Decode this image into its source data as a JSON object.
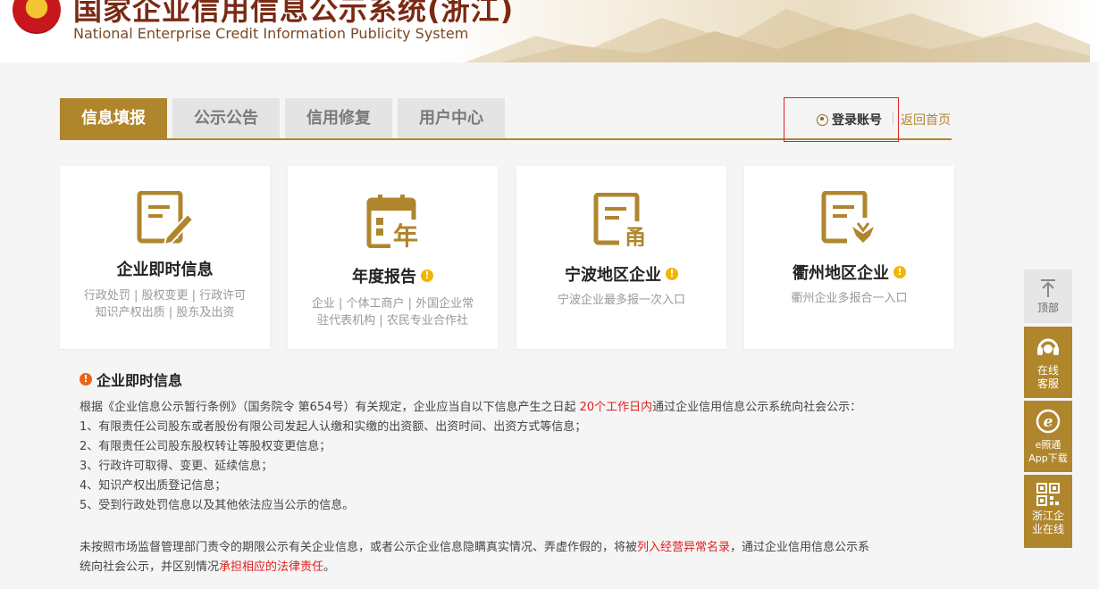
{
  "header": {
    "title_cn": "国家企业信用信息公示系统(浙江)",
    "title_en": "National Enterprise Credit Information Publicity System"
  },
  "tabs": [
    {
      "label": "信息填报",
      "active": true
    },
    {
      "label": "公示公告",
      "active": false
    },
    {
      "label": "信用修复",
      "active": false
    },
    {
      "label": "用户中心",
      "active": false
    }
  ],
  "top_links": {
    "login": "登录账号",
    "home": "返回首页"
  },
  "cards": [
    {
      "title": "企业即时信息",
      "desc": [
        "行政处罚 | 股权变更 | 行政许可",
        "知识产权出质 | 股东及出资"
      ],
      "warn": false,
      "icon": "document-pen-icon"
    },
    {
      "title": "年度报告",
      "desc": [
        "企业 | 个体工商户 | 外国企业常",
        "驻代表机构 | 农民专业合作社"
      ],
      "warn": true,
      "icon": "calendar-year-icon",
      "icon_text": "年"
    },
    {
      "title": "宁波地区企业",
      "desc": [
        "宁波企业最多报一次入口"
      ],
      "warn": true,
      "icon": "document-ningbo-icon",
      "icon_text": "甬"
    },
    {
      "title": "衢州地区企业",
      "desc": [
        "衢州企业多报合一入口"
      ],
      "warn": true,
      "icon": "document-quzhou-icon"
    }
  ],
  "info": {
    "title": "企业即时信息",
    "para1_a": "根据《企业信息公示暂行条例》（国务院令 第654号）有关规定，企业应当自以下信息产生之日起 ",
    "para1_red": "20个工作日内",
    "para1_b": "通过企业信用信息公示系统向社会公示：",
    "items": [
      "1、有限责任公司股东或者股份有限公司发起人认缴和实缴的出资额、出资时间、出资方式等信息；",
      "2、有限责任公司股东股权转让等股权变更信息；",
      "3、行政许可取得、变更、延续信息；",
      "4、知识产权出质登记信息；",
      "5、受到行政处罚信息以及其他依法应当公示的信息。"
    ],
    "para2_a": "未按照市场监督管理部门责令的期限公示有关企业信息，或者公示企业信息隐瞒真实情况、弄虚作假的，将被",
    "para2_red1": "列入经营异常名录",
    "para2_b": "，通过企业信用信息公示系",
    "para3_a": "统向社会公示，并区别情况",
    "para3_red": "承担相应的法律责任",
    "para3_b": "。"
  },
  "sidebar": {
    "top": "顶部",
    "service": [
      "在线",
      "客服"
    ],
    "app": [
      "e照通",
      "App下载"
    ],
    "online": [
      "浙江企",
      "业在线"
    ]
  },
  "colors": {
    "accent": "#b0862d",
    "highlight_border": "#e0201e",
    "warning": "#f2b600"
  }
}
